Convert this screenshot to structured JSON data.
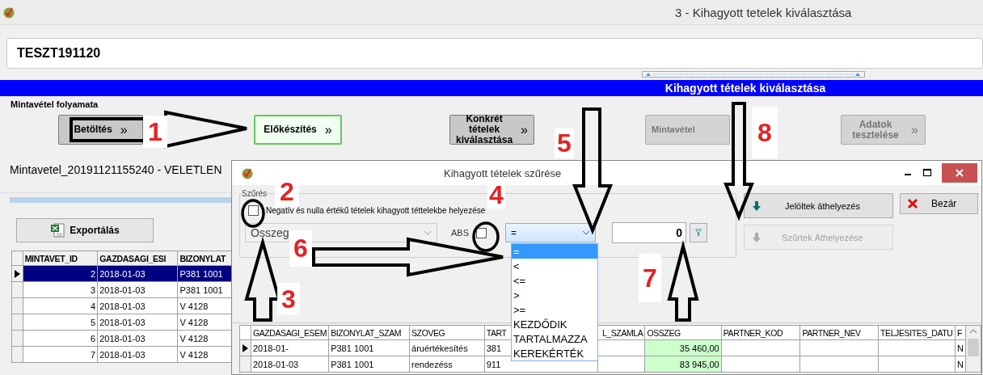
{
  "window": {
    "title": "3 - Kihagyott tetelek kiválasztása"
  },
  "project_field": {
    "value": "TESZT191120"
  },
  "banner": {
    "title": "Kihagyott tételek kiválasztása"
  },
  "process": {
    "label": "Mintavétel folyamata",
    "steps": [
      {
        "label": "Betöltés",
        "chevron": "»",
        "selected": false,
        "disabled": false
      },
      {
        "label": "Előkészítés",
        "chevron": "»",
        "selected": true,
        "disabled": false
      },
      {
        "label": "Konkrét tételek kiválasztása",
        "chevron": "»",
        "selected": false,
        "disabled": false
      },
      {
        "label": "Mintavétel",
        "selected": false,
        "disabled": true
      },
      {
        "label": "Adatok tesztelése",
        "chevron": "»",
        "selected": false,
        "disabled": true
      }
    ]
  },
  "sample_name": "Mintavetel_20191121155240 - VELETLEN",
  "export_button": {
    "label": "Exportálás"
  },
  "sample_table": {
    "columns": [
      "MINTAVET_ID",
      "GAZDASAGI_ESI",
      "BIZONYLAT"
    ],
    "rows": [
      {
        "cells": [
          "2",
          "2018-01-03",
          "P381   1001"
        ],
        "selected": true
      },
      {
        "cells": [
          "3",
          "2018-01-03",
          "P381   1001"
        ],
        "selected": false
      },
      {
        "cells": [
          "4",
          "2018-01-03",
          "V        4128"
        ],
        "selected": false
      },
      {
        "cells": [
          "5",
          "2018-01-03",
          "V        4128"
        ],
        "selected": false
      },
      {
        "cells": [
          "6",
          "2018-01-03",
          "V        4128"
        ],
        "selected": false
      },
      {
        "cells": [
          "7",
          "2018-01-03",
          "V        4128"
        ],
        "selected": false
      }
    ]
  },
  "dialog": {
    "title": "Kihagyott tételek szűrése",
    "filter_group": {
      "legend": "Szűrés",
      "negative_checkbox": {
        "label": "Negatív és nulla értékű tételek kihagyott téttelekbe helyezése",
        "checked": false
      },
      "field_combo": {
        "value": "Osszeg"
      },
      "abs_checkbox": {
        "label": "ABS",
        "checked": false
      },
      "operator_combo": {
        "value": "=",
        "expanded": true,
        "options": [
          {
            "label": "=",
            "selected": true
          },
          {
            "label": "<",
            "selected": false
          },
          {
            "label": "<=",
            "selected": false
          },
          {
            "label": ">",
            "selected": false
          },
          {
            "label": ">=",
            "selected": false
          },
          {
            "label": "KEZDŐDIK",
            "selected": false
          },
          {
            "label": "TARTALMAZZA",
            "selected": false
          },
          {
            "label": "KEREKÉRTÉK",
            "selected": false
          }
        ]
      },
      "value_field": {
        "value": "0"
      }
    },
    "move_marked_button": {
      "label": "Jelöltek áthelyezés",
      "disabled": false
    },
    "move_filtered_button": {
      "label": "Szűrtek Áthelyezése",
      "disabled": true
    },
    "close_button": {
      "label": "Bezár"
    },
    "grid": {
      "columns": [
        "GAZDASAGI_ESEM",
        "BIZONYLAT_SZAM",
        "SZOVEG",
        "TART",
        "L_SZAMLA",
        "OSSZEG",
        "PARTNER_KOD",
        "PARTNER_NEV",
        "TELJESITES_DATU",
        "F"
      ],
      "rows": [
        {
          "cells": [
            "2018-01-",
            "P381   1001",
            "áruértékesítés",
            "381",
            "",
            "35 460,00",
            "",
            "",
            "",
            "N"
          ],
          "selected": true
        },
        {
          "cells": [
            "2018-01-03",
            "P381   1001",
            "rendezéss",
            "911",
            "",
            "83 945,00",
            "",
            "",
            "",
            "N"
          ],
          "selected": false
        }
      ]
    }
  },
  "annotations": {
    "markers": [
      "1",
      "2",
      "3",
      "4",
      "5",
      "6",
      "7",
      "8"
    ]
  }
}
